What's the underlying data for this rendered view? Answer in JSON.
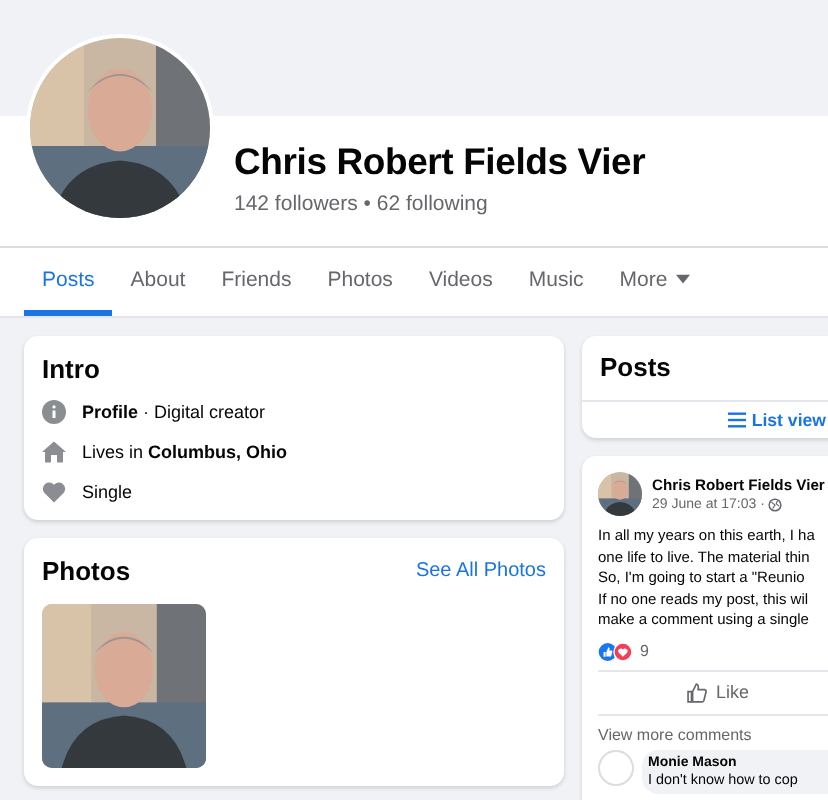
{
  "profile": {
    "name": "Chris Robert Fields Vier",
    "stats": "142 followers • 62 following"
  },
  "tabs": [
    {
      "label": "Posts",
      "selected": true
    },
    {
      "label": "About",
      "selected": false
    },
    {
      "label": "Friends",
      "selected": false
    },
    {
      "label": "Photos",
      "selected": false
    },
    {
      "label": "Videos",
      "selected": false
    },
    {
      "label": "Music",
      "selected": false
    },
    {
      "label": "More",
      "selected": false,
      "kind": "menu"
    }
  ],
  "intro": {
    "title": "Intro",
    "items": [
      {
        "kind": "info",
        "text": "**Profile** · Digital creator"
      },
      {
        "kind": "home",
        "text": "Lives in **Columbus, Ohio**"
      },
      {
        "kind": "heart",
        "text": "Single"
      }
    ]
  },
  "photos": {
    "title": "Photos",
    "link": "See All Photos"
  },
  "posts_panel": {
    "title": "Posts",
    "view": "List view"
  },
  "post": {
    "author": "Chris Robert Fields Vier",
    "time": "29 June at 17:03 ·",
    "lines": [
      "In all my years on this earth, I ha",
      "one life to live. The material thin",
      "So, I'm going to start a \"Reunio",
      "If no one reads my post, this wil",
      "make a comment using a single"
    ],
    "reaction_count": "9",
    "action": "Like",
    "more_comments": "View more comments",
    "comment": {
      "author": "Monie Mason",
      "text": "I don't know how to cop"
    }
  }
}
